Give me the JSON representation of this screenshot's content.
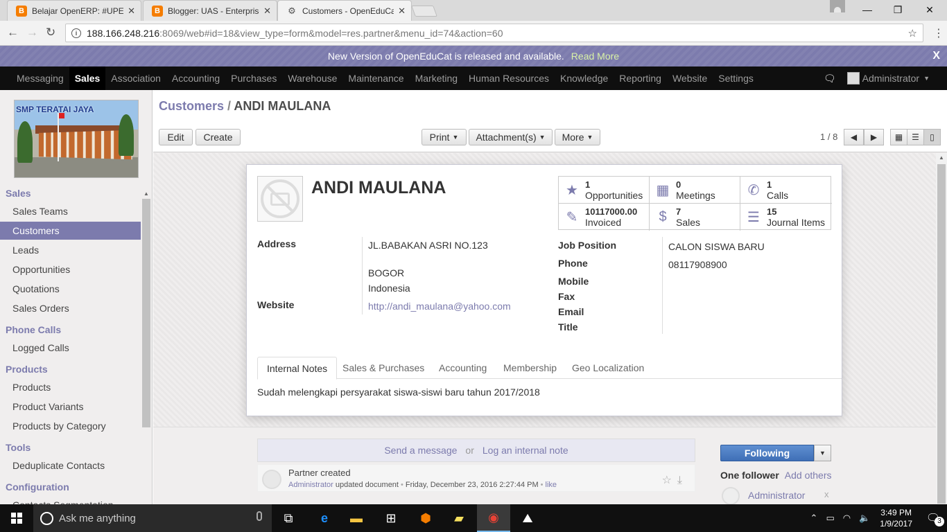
{
  "browser": {
    "tabs": [
      {
        "title": "Belajar OpenERP: #UPERI",
        "favicon": "blogger-icon"
      },
      {
        "title": "Blogger: UAS - Enterprise",
        "favicon": "blogger-icon"
      },
      {
        "title": "Customers - OpenEduCat",
        "favicon": "odoo-icon"
      }
    ],
    "url_host": "188.166.248.216",
    "url_path": ":8069/web#id=18&view_type=form&model=res.partner&menu_id=74&action=60"
  },
  "banner": {
    "text": "New Version of OpenEduCat is released and available.",
    "link": "Read More",
    "close": "X"
  },
  "topmenu": {
    "items": [
      "Messaging",
      "Sales",
      "Association",
      "Accounting",
      "Purchases",
      "Warehouse",
      "Maintenance",
      "Marketing",
      "Human Resources",
      "Knowledge",
      "Reporting",
      "Website",
      "Settings"
    ],
    "active": "Sales",
    "user": "Administrator"
  },
  "sidebar": {
    "logo_text": "SMP TERATAI JAYA",
    "sections": [
      {
        "title": "Sales",
        "items": [
          "Sales Teams",
          "Customers",
          "Leads",
          "Opportunities",
          "Quotations",
          "Sales Orders"
        ]
      },
      {
        "title": "Phone Calls",
        "items": [
          "Logged Calls"
        ]
      },
      {
        "title": "Products",
        "items": [
          "Products",
          "Product Variants",
          "Products by Category"
        ]
      },
      {
        "title": "Tools",
        "items": [
          "Deduplicate Contacts"
        ]
      },
      {
        "title": "Configuration",
        "items": [
          "Contacts Segmentation"
        ]
      }
    ],
    "active_item": "Customers"
  },
  "control_panel": {
    "breadcrumb_parent": "Customers",
    "breadcrumb_sep": "/",
    "breadcrumb_current": "ANDI MAULANA",
    "edit": "Edit",
    "create": "Create",
    "print": "Print",
    "attachments": "Attachment(s)",
    "more": "More",
    "pager": "1 / 8"
  },
  "partner": {
    "name": "ANDI MAULANA",
    "stats": [
      {
        "value": "1",
        "label": "Opportunities",
        "icon": "star-icon"
      },
      {
        "value": "0",
        "label": "Meetings",
        "icon": "calendar-icon"
      },
      {
        "value": "1",
        "label": "Calls",
        "icon": "phone-icon"
      },
      {
        "value": "10117000.00",
        "label": "Invoiced",
        "icon": "edit-icon"
      },
      {
        "value": "7",
        "label": "Sales",
        "icon": "dollar-icon"
      },
      {
        "value": "15",
        "label": "Journal Items",
        "icon": "list-icon"
      }
    ],
    "address_label": "Address",
    "street": "JL.BABAKAN ASRI NO.123",
    "city": "BOGOR",
    "country": "Indonesia",
    "website_label": "Website",
    "website": "http://andi_maulana@yahoo.com",
    "job_label": "Job Position",
    "job": "CALON SISWA BARU",
    "phone_label": "Phone",
    "phone": "08117908900",
    "mobile_label": "Mobile",
    "fax_label": "Fax",
    "email_label": "Email",
    "title_label": "Title"
  },
  "notebook": {
    "tabs": [
      "Internal Notes",
      "Sales & Purchases",
      "Accounting",
      "Membership",
      "Geo Localization"
    ],
    "active": "Internal Notes",
    "note": "Sudah melengkapi persyarakat siswa-siswi baru tahun 2017/2018"
  },
  "chatter": {
    "send_message": "Send a message",
    "or": "or",
    "log_note": "Log an internal note",
    "message_title": "Partner created",
    "message_author": "Administrator",
    "message_action": "updated document",
    "message_date": "Friday, December 23, 2016 2:27:44 PM",
    "message_like": "like",
    "following": "Following",
    "followers_count": "One follower",
    "add_others": "Add others",
    "follower_name": "Administrator",
    "remove": "x"
  },
  "taskbar": {
    "search_placeholder": "Ask me anything",
    "time": "3:49 PM",
    "date": "1/9/2017",
    "notifications": "3"
  }
}
